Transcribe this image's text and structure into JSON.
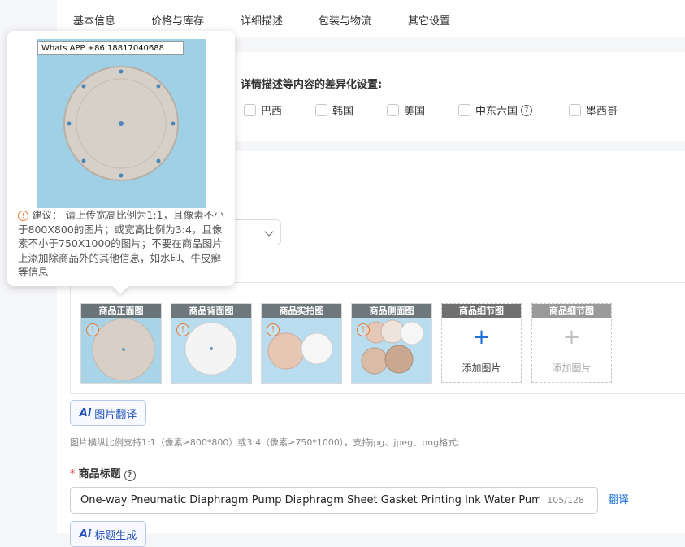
{
  "tabs": [
    "基本信息",
    "价格与库存",
    "详细描述",
    "包装与物流",
    "其它设置"
  ],
  "diff": {
    "title": "详情描述等内容的差异化设置:",
    "options": [
      "巴西",
      "韩国",
      "美国",
      "中东六国",
      "墨西哥"
    ],
    "help_glyph": "?"
  },
  "images": [
    {
      "label": "商品正面图",
      "warn": "!"
    },
    {
      "label": "商品背面图",
      "warn": "!"
    },
    {
      "label": "商品实拍图",
      "warn": "!"
    },
    {
      "label": "商品侧面图",
      "warn": "!"
    }
  ],
  "add_slots": [
    {
      "label": "商品细节图",
      "text": "添加图片",
      "plus": "+"
    },
    {
      "label": "商品细节图",
      "text": "添加图片",
      "plus": "+"
    }
  ],
  "ai_translate": {
    "ai": "Ai",
    "label": "图片翻译"
  },
  "hint": "图片横纵比例支持1:1（像素≥800*800）或3:4（像素≥750*1000），支持jpg、jpeg、png格式;",
  "title_field": {
    "star": "*",
    "label": "商品标题",
    "value": "One-way Pneumatic Diaphragm Pump Diaphragm Sheet Gasket Printing Ink Water Pump Oil",
    "count": "105/128",
    "translate": "翻译"
  },
  "ai_title": {
    "ai": "Ai",
    "label": "标题生成"
  },
  "popover": {
    "watermark": "Whats APP +86 18817040688",
    "tip": "建议： 请上传宽高比例为1:1，且像素不小于800X800的图片；或宽高比例为3:4，且像素不小于750X1000的图片；不要在商品图片上添加除商品外的其他信息，如水印、牛皮癣等信息"
  },
  "colors": {
    "accent": "#1e6fd9",
    "warning": "#e8772e",
    "required": "#e4393c"
  }
}
